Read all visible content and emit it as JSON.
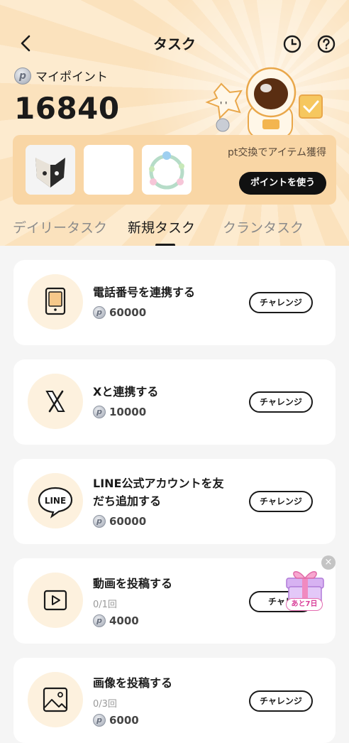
{
  "header": {
    "title": "タスク",
    "my_point_label": "マイポイント",
    "points": "16840",
    "exchange_text": "pt交換でアイテム獲得",
    "use_points_button": "ポイントを使う",
    "coin_symbol": "p"
  },
  "tabs": [
    {
      "label": "デイリータスク",
      "active": false
    },
    {
      "label": "新規タスク",
      "active": true
    },
    {
      "label": "クランタスク",
      "active": false
    }
  ],
  "tasks": [
    {
      "title": "電話番号を連携する",
      "title2": "",
      "progress": "",
      "points": "60000",
      "button": "チャレンジ",
      "icon": "phone-icon"
    },
    {
      "title": "Xと連携する",
      "title2": "",
      "progress": "",
      "points": "10000",
      "button": "チャレンジ",
      "icon": "x-logo-icon"
    },
    {
      "title": "LINE公式アカウントを友",
      "title2": "だち追加する",
      "progress": "",
      "points": "60000",
      "button": "チャレンジ",
      "icon": "line-logo-icon"
    },
    {
      "title": "動画を投稿する",
      "title2": "",
      "progress": "0/1回",
      "points": "4000",
      "button": "チャレ",
      "icon": "video-icon"
    },
    {
      "title": "画像を投稿する",
      "title2": "",
      "progress": "0/3回",
      "points": "6000",
      "button": "チャレンジ",
      "icon": "image-icon"
    }
  ],
  "gift": {
    "badge": "あと7日",
    "close": "×"
  },
  "colors": {
    "header_bg": "#fbe2bd",
    "exchange_bg": "#f9d6a5",
    "icon_circle": "#fdf1de",
    "accent": "#f0a63a"
  }
}
